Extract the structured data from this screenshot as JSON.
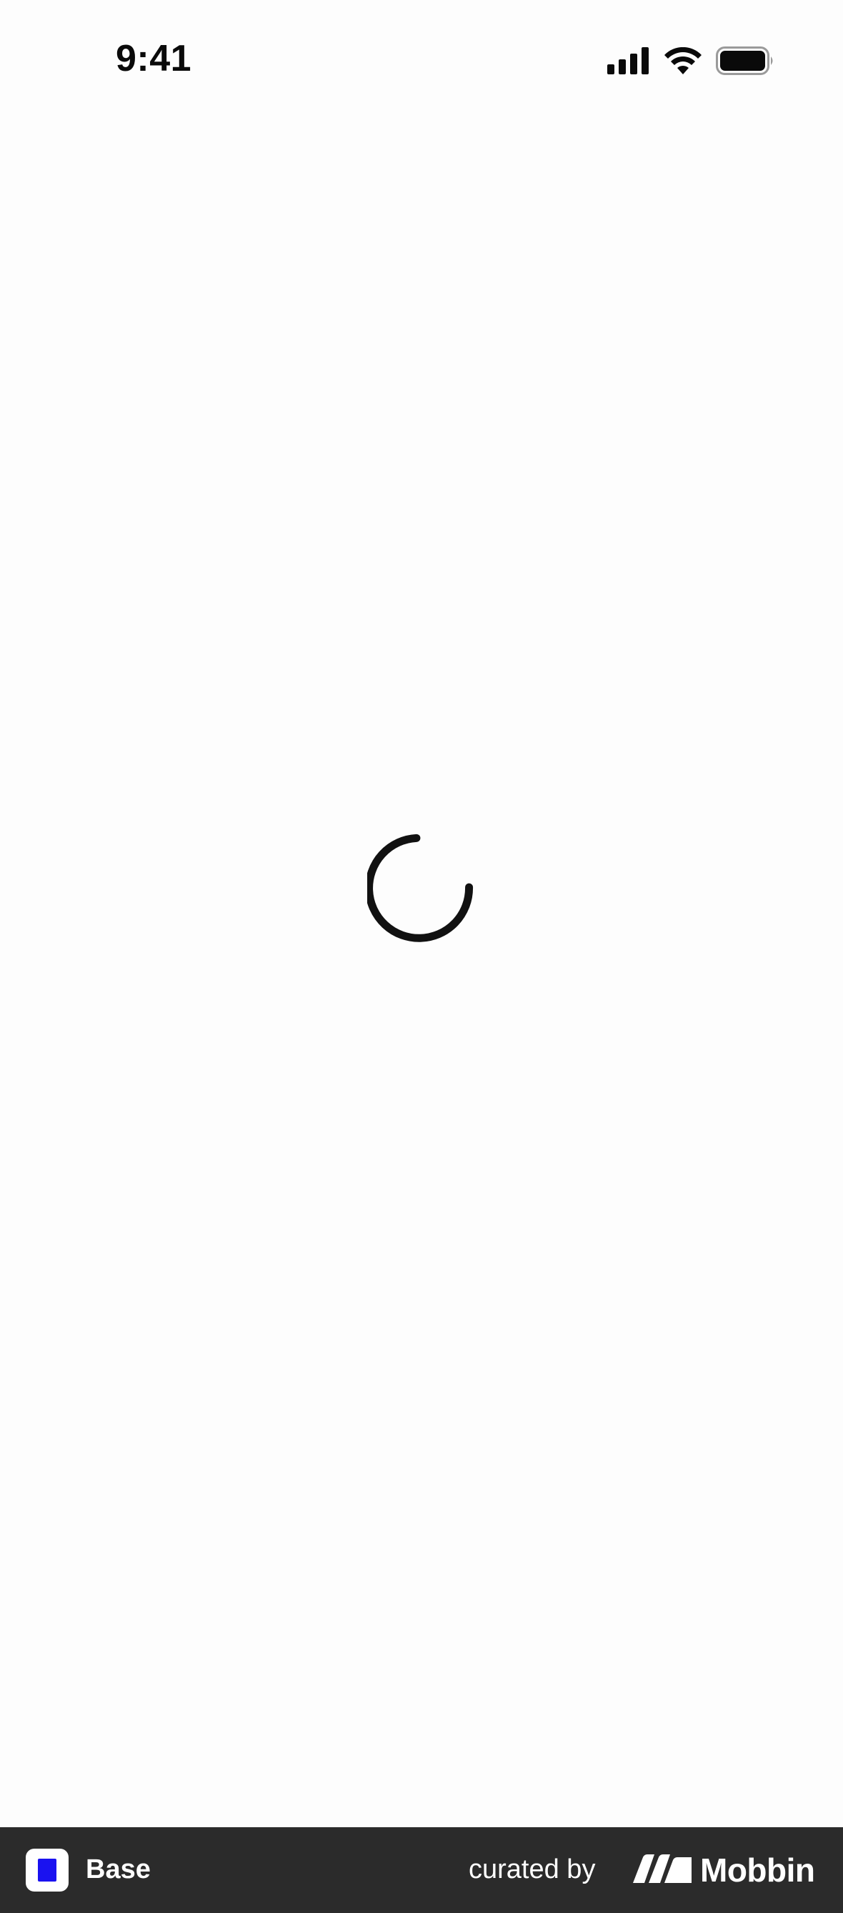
{
  "status_bar": {
    "time": "9:41",
    "icons": [
      "cellular-signal-icon",
      "wifi-icon",
      "battery-icon"
    ]
  },
  "main": {
    "loading_indicator": "spinner-icon"
  },
  "footer": {
    "app_name": "Base",
    "curated_by": "curated by",
    "brand_name": "Mobbin",
    "colors": {
      "background": "#2b2b2b",
      "app_badge_accent": "#1a12f0",
      "text": "#ffffff"
    }
  }
}
